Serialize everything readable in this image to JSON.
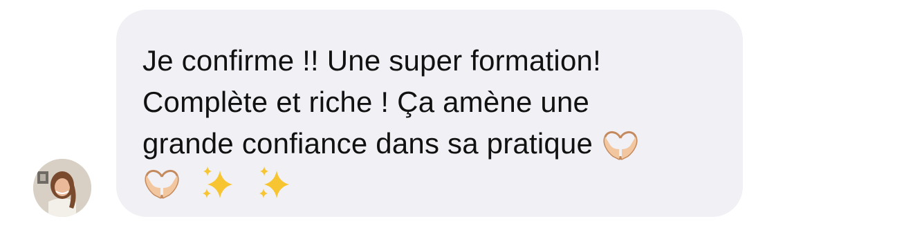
{
  "message": {
    "lines": [
      "Je confirme !! Une super formation!",
      "Complète et riche ! Ça amène une",
      "grande confiance dans sa pratique"
    ],
    "emojis": [
      "heart-hands",
      "heart-hands",
      "sparkles",
      "sparkles"
    ]
  },
  "colors": {
    "bubble": "#f0f0f5",
    "text": "#111111",
    "sparkle": "#f7c531",
    "skin": "#f2c79f"
  }
}
